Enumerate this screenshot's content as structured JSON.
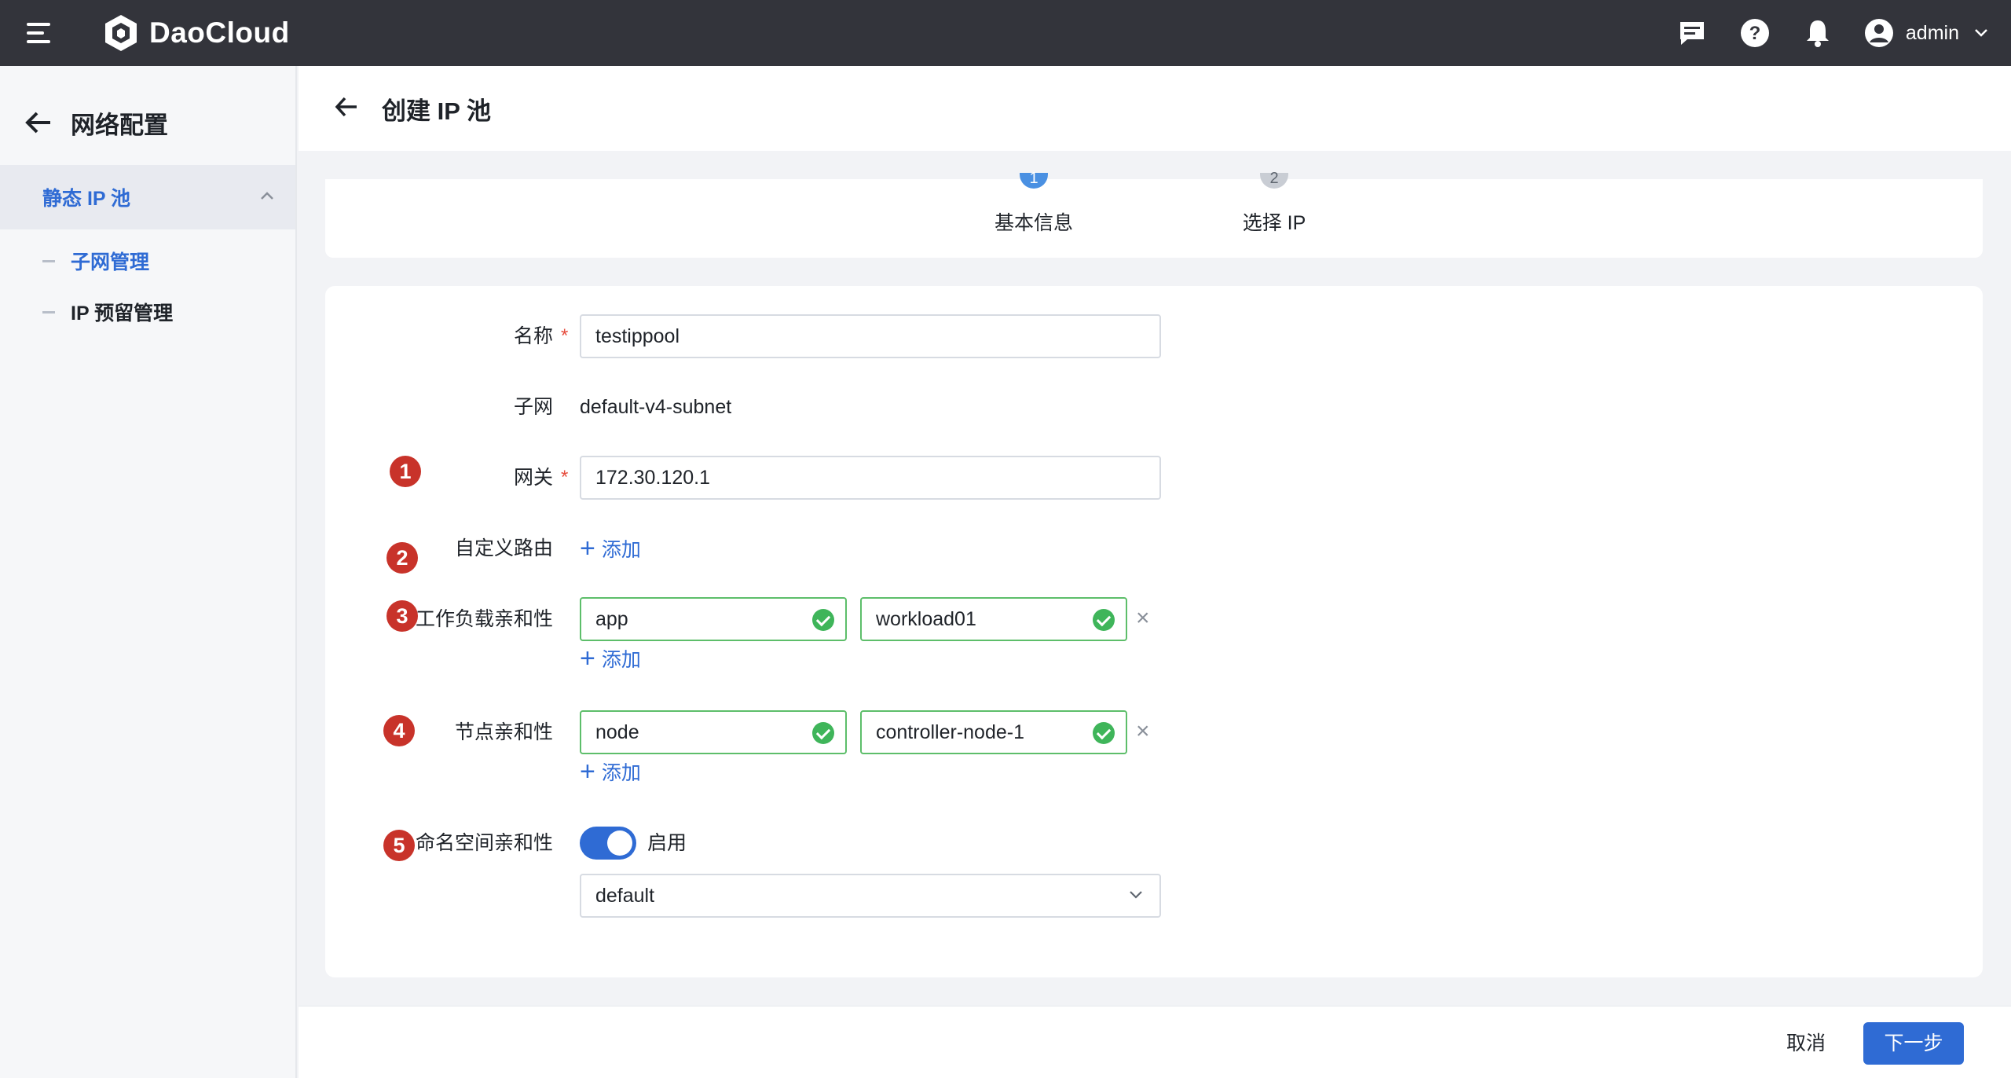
{
  "topbar": {
    "brand": "DaoCloud",
    "user": "admin",
    "icons": [
      "menu-icon",
      "message-icon",
      "help-icon",
      "bell-icon",
      "user-avatar-icon",
      "chevron-down-icon"
    ]
  },
  "sidebar": {
    "title": "网络配置",
    "group": "静态 IP 池",
    "items": [
      {
        "label": "子网管理",
        "active": true
      },
      {
        "label": "IP 预留管理",
        "active": false
      }
    ]
  },
  "page": {
    "title": "创建 IP 池"
  },
  "steps": [
    {
      "num": "1",
      "label": "基本信息",
      "state": "active"
    },
    {
      "num": "2",
      "label": "选择 IP",
      "state": "pending"
    }
  ],
  "form": {
    "name": {
      "label": "名称",
      "value": "testippool"
    },
    "subnet": {
      "label": "子网",
      "value": "default-v4-subnet"
    },
    "gateway": {
      "label": "网关",
      "value": "172.30.120.1"
    },
    "routes": {
      "label": "自定义路由",
      "add": "添加"
    },
    "workload_affinity": {
      "label": "工作负载亲和性",
      "key": "app",
      "value": "workload01",
      "add": "添加"
    },
    "node_affinity": {
      "label": "节点亲和性",
      "key": "node",
      "value": "controller-node-1",
      "add": "添加"
    },
    "namespace_affinity": {
      "label": "命名空间亲和性",
      "toggle_label": "启用",
      "enabled": true,
      "selected": "default"
    },
    "required_mark": "*",
    "remove_symbol": "×",
    "add_symbol": "+"
  },
  "annotations": [
    "1",
    "2",
    "3",
    "4",
    "5"
  ],
  "footer": {
    "cancel": "取消",
    "next": "下一步"
  },
  "colors": {
    "topbar": "#33343b",
    "accent": "#2f6bd4",
    "success": "#3fb55a",
    "annotation": "#c8332a",
    "required": "#e64b3c"
  }
}
